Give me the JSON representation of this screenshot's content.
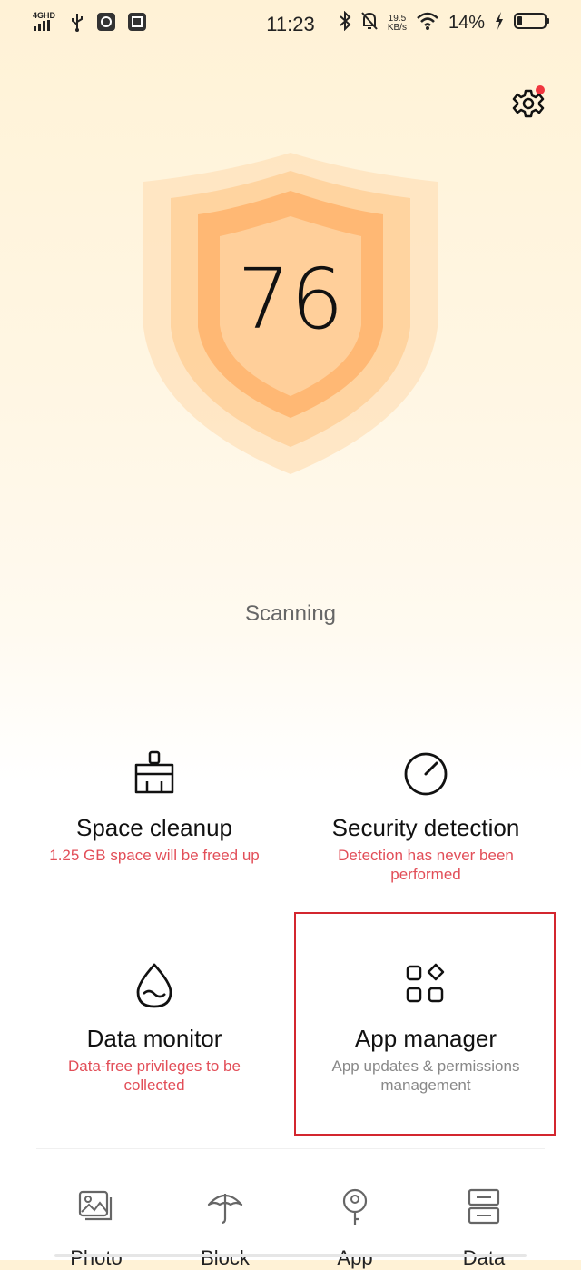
{
  "status_bar": {
    "network": "4GHD",
    "time": "11:23",
    "speed_value": "19.5",
    "speed_unit": "KB/s",
    "battery": "14%",
    "icons": [
      "signal-icon",
      "usb-icon",
      "app-notification-icon",
      "taobao-icon",
      "bluetooth-icon",
      "mute-icon",
      "wifi-icon",
      "charging-icon",
      "battery-icon"
    ]
  },
  "header": {
    "settings_icon": "gear-icon",
    "has_notification": true
  },
  "score": {
    "value": "76",
    "status": "Scanning",
    "shield_color": "#ffab5e"
  },
  "cards": [
    {
      "title": "Space cleanup",
      "desc": "1.25 GB space will be freed up",
      "icon": "broom-icon"
    },
    {
      "title": "Security detection",
      "desc": "Detection has never been performed",
      "icon": "gauge-icon"
    },
    {
      "title": "Data monitor",
      "desc": "Data-free privileges to be collected",
      "icon": "water-drop-icon"
    },
    {
      "title": "App manager",
      "desc": "App updates & permissions management",
      "icon": "apps-grid-icon"
    }
  ],
  "tools": [
    {
      "label": "Photo",
      "icon": "photo-icon"
    },
    {
      "label": "Block",
      "icon": "umbrella-icon"
    },
    {
      "label": "App",
      "icon": "app-lock-icon"
    },
    {
      "label": "Data",
      "icon": "data-storage-icon"
    }
  ],
  "colors": {
    "accent_warning": "#e24e58",
    "highlight_border": "#d3262f",
    "notification_dot": "#f0363f"
  }
}
